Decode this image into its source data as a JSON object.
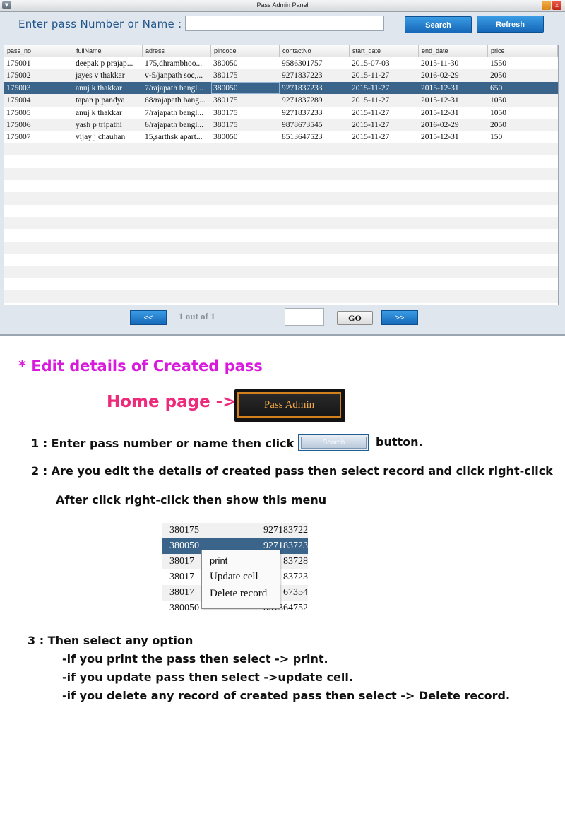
{
  "window": {
    "title": "Pass Admin Panel",
    "menu_icon": "chevron-down-icon",
    "min_label": "_",
    "close_label": "x"
  },
  "search": {
    "label": "Enter pass Number or Name  :",
    "value": "",
    "search_label": "Search",
    "refresh_label": "Refresh"
  },
  "table": {
    "columns": [
      "pass_no",
      "fullName",
      "adress",
      "pincode",
      "contactNo",
      "start_date",
      "end_date",
      "price"
    ],
    "rows": [
      [
        "175001",
        "deepak p prajap...",
        "175,dhrambhoo...",
        "380050",
        "9586301757",
        "2015-07-03",
        "2015-11-30",
        "1550"
      ],
      [
        "175002",
        "jayes v thakkar",
        "v-5/janpath soc,...",
        "380175",
        "9271837223",
        "2015-11-27",
        "2016-02-29",
        "2050"
      ],
      [
        "175003",
        "anuj k thakkar",
        "7/rajapath bangl...",
        "380050",
        "9271837233",
        "2015-11-27",
        "2015-12-31",
        "650"
      ],
      [
        "175004",
        "tapan p pandya",
        "68/rajapath bang...",
        "380175",
        "9271837289",
        "2015-11-27",
        "2015-12-31",
        "1050"
      ],
      [
        "175005",
        "anuj k thakkar",
        "7/rajapath bangl...",
        "380175",
        "9271837233",
        "2015-11-27",
        "2015-12-31",
        "1050"
      ],
      [
        "175006",
        "yash p tripathi",
        "6/rajapath bangl...",
        "380175",
        "9878673545",
        "2015-11-27",
        "2016-02-29",
        "2050"
      ],
      [
        "175007",
        "vijay j chauhan",
        "15,sarthsk apart...",
        "380050",
        "8513647523",
        "2015-11-27",
        "2015-12-31",
        "150"
      ]
    ],
    "selected_row": 2,
    "selection_color": "#3a6489"
  },
  "pager": {
    "prev_label": "<<",
    "next_label": ">>",
    "info": "1 out of 1",
    "page_value": "",
    "go_label": "GO"
  },
  "doc": {
    "heading": "* Edit details of Created pass",
    "home_label": "Home page ->",
    "pass_admin_label": "Pass Admin",
    "step1_text": "1 :  Enter pass number or name  then click",
    "step1_btn": "Search",
    "step1_after": "button.",
    "step2_text": "2 : Are you edit the details of created pass then select record and click right-click",
    "step2_sub": "After click right-click  then show this menu",
    "context_rows": [
      [
        "380175",
        "927183722"
      ],
      [
        "380050",
        "927183723"
      ],
      [
        "38017",
        "83728"
      ],
      [
        "38017",
        "83723"
      ],
      [
        "38017",
        "67354"
      ],
      [
        "380050",
        "851364752"
      ]
    ],
    "context_menu": [
      "print",
      "Update cell",
      "Delete record"
    ],
    "step3_text": "3 : Then select any option",
    "step3_a": "-if you print the pass then select -> print.",
    "step3_b": "-if you update pass then select ->update cell.",
    "step3_c": "-if you delete any record of created pass then select -> Delete record.",
    "heading_color": "#d81adc",
    "home_color": "#ee2a7b"
  }
}
